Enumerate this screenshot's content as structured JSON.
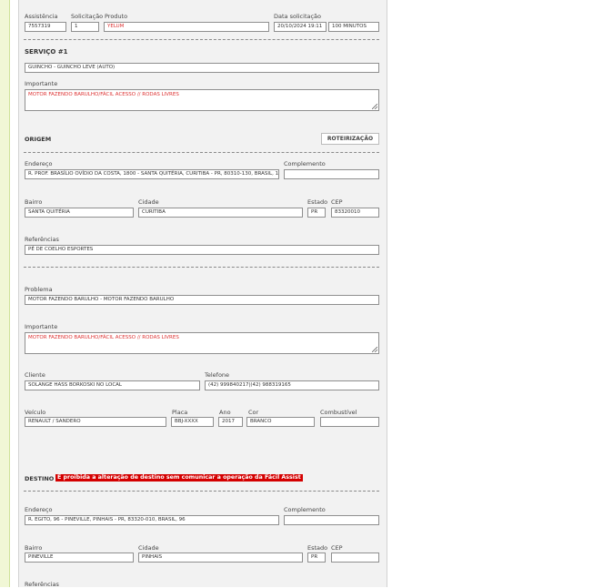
{
  "top": {
    "assistencia_label": "Assistência",
    "assistencia": "7557319",
    "solicitacao_label": "Solicitação",
    "solicitacao": "1",
    "produto_label": "Produto",
    "produto": "YELUM",
    "data_label": "Data solicitação",
    "data": "20/10/2024 19:11",
    "tempo": "100 MINUTOS"
  },
  "servico": {
    "title": "SERVIÇO #1",
    "tipo": "GUINCHO - GUINCHO LEVE (AUTO)",
    "importante_label": "Importante",
    "importante": "MOTOR FAZENDO BARULHO/FÁCIL ACESSO // RODAS LIVRES"
  },
  "origem": {
    "title": "ORIGEM",
    "button": "ROTEIRIZAÇÃO",
    "endereco_label": "Endereço",
    "endereco": "R. PROF. BRASÍLIO OVÍDIO DA COSTA, 1800 - SANTA QUITÉRIA, CURITIBA - PR, 80310-130, BRASIL, 1",
    "complemento_label": "Complemento",
    "complemento": "",
    "bairro_label": "Bairro",
    "bairro": "SANTA QUITÉRIA",
    "cidade_label": "Cidade",
    "cidade": "CURITIBA",
    "estado_label": "Estado",
    "estado": "PR",
    "cep_label": "CEP",
    "cep": "83320010",
    "referencias_label": "Referências",
    "referencias": "PÉ DE COELHO ESPORTES"
  },
  "detalhes": {
    "problema_label": "Problema",
    "problema": "MOTOR FAZENDO BARULHO - MOTOR FAZENDO BARULHO",
    "importante_label": "Importante",
    "importante": "MOTOR FAZENDO BARULHO/FÁCIL ACESSO // RODAS LIVRES",
    "cliente_label": "Cliente",
    "cliente": "SOLANGE HASS BORKOSKI NO LOCAL",
    "telefone_label": "Telefone",
    "telefone": "(42) 999840217|(42) 988319165",
    "veiculo_label": "Veículo",
    "veiculo": "RENAULT / SANDERO",
    "placa_label": "Placa",
    "placa": "BBJ-XXXX",
    "ano_label": "Ano",
    "ano": "2017",
    "cor_label": "Cor",
    "cor": "BRANCO",
    "combustivel_label": "Combustível",
    "combustivel": ""
  },
  "destino": {
    "title": "DESTINO",
    "warning": "É proibida a alteração de destino sem comunicar a operação da Fácil Assist",
    "endereco_label": "Endereço",
    "endereco": "R. EGITO, 96 - PINEVILLE, PINHAIS - PR, 83320-010, BRASIL, 96",
    "complemento_label": "Complemento",
    "complemento": "",
    "bairro_label": "Bairro",
    "bairro": "PINEVILLE",
    "cidade_label": "Cidade",
    "cidade": "PINHAIS",
    "estado_label": "Estado",
    "estado": "PR",
    "cep_label": "CEP",
    "cep": "",
    "referencias_label": "Referências"
  }
}
